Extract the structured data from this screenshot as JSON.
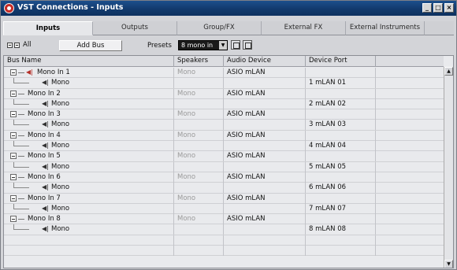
{
  "window": {
    "title": "VST Connections - Inputs"
  },
  "tabs": [
    {
      "label": "Inputs",
      "active": true
    },
    {
      "label": "Outputs",
      "active": false
    },
    {
      "label": "Group/FX",
      "active": false
    },
    {
      "label": "External FX",
      "active": false
    },
    {
      "label": "External Instruments",
      "active": false
    }
  ],
  "toolbar": {
    "all_label": "All",
    "add_bus_label": "Add Bus",
    "presets_label": "Presets",
    "presets_value": "8 mono in"
  },
  "table": {
    "headers": [
      "Bus Name",
      "Speakers",
      "Audio Device",
      "Device Port"
    ],
    "rows": [
      {
        "kind": "bus",
        "name": "Mono In 1",
        "speakers": "Mono",
        "device": "ASIO mLAN",
        "port": ""
      },
      {
        "kind": "channel",
        "name": "Mono",
        "speakers": "",
        "device": "",
        "port": "1 mLAN 01"
      },
      {
        "kind": "bus",
        "name": "Mono In 2",
        "speakers": "Mono",
        "device": "ASIO mLAN",
        "port": ""
      },
      {
        "kind": "channel",
        "name": "Mono",
        "speakers": "",
        "device": "",
        "port": "2 mLAN 02"
      },
      {
        "kind": "bus",
        "name": "Mono In 3",
        "speakers": "Mono",
        "device": "ASIO mLAN",
        "port": ""
      },
      {
        "kind": "channel",
        "name": "Mono",
        "speakers": "",
        "device": "",
        "port": "3 mLAN 03"
      },
      {
        "kind": "bus",
        "name": "Mono In 4",
        "speakers": "Mono",
        "device": "ASIO mLAN",
        "port": ""
      },
      {
        "kind": "channel",
        "name": "Mono",
        "speakers": "",
        "device": "",
        "port": "4 mLAN 04"
      },
      {
        "kind": "bus",
        "name": "Mono In 5",
        "speakers": "Mono",
        "device": "ASIO mLAN",
        "port": ""
      },
      {
        "kind": "channel",
        "name": "Mono",
        "speakers": "",
        "device": "",
        "port": "5 mLAN 05"
      },
      {
        "kind": "bus",
        "name": "Mono In 6",
        "speakers": "Mono",
        "device": "ASIO mLAN",
        "port": ""
      },
      {
        "kind": "channel",
        "name": "Mono",
        "speakers": "",
        "device": "",
        "port": "6 mLAN 06"
      },
      {
        "kind": "bus",
        "name": "Mono In 7",
        "speakers": "Mono",
        "device": "ASIO mLAN",
        "port": ""
      },
      {
        "kind": "channel",
        "name": "Mono",
        "speakers": "",
        "device": "",
        "port": "7 mLAN 07"
      },
      {
        "kind": "bus",
        "name": "Mono In 8",
        "speakers": "Mono",
        "device": "ASIO mLAN",
        "port": ""
      },
      {
        "kind": "channel",
        "name": "Mono",
        "speakers": "",
        "device": "",
        "port": "8 mLAN 08"
      }
    ]
  },
  "window_buttons": [
    "_",
    "□",
    "×"
  ]
}
